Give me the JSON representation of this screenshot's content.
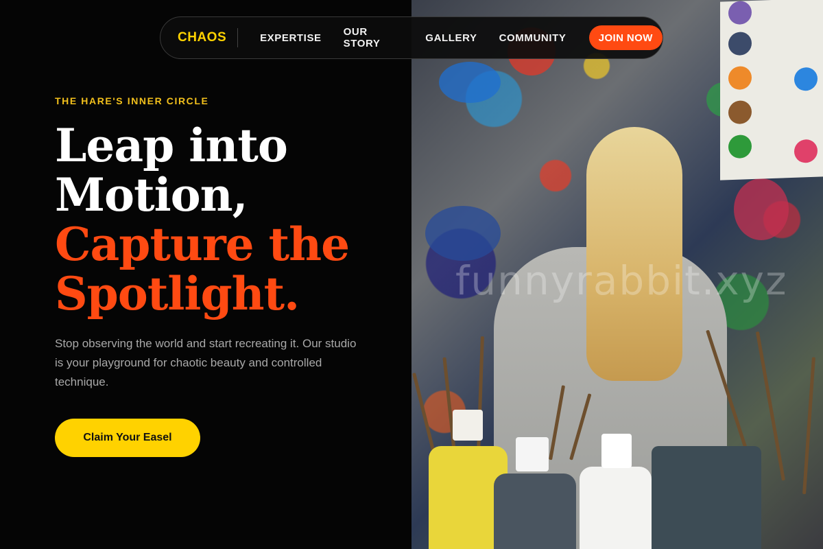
{
  "nav": {
    "brand": "CHAOS",
    "links": [
      "EXPERTISE",
      "OUR STORY",
      "GALLERY",
      "COMMUNITY"
    ],
    "cta": "JOIN NOW"
  },
  "hero": {
    "eyebrow": "THE HARE'S INNER CIRCLE",
    "headline_line1": "Leap into",
    "headline_line2": "Motion,",
    "headline_line3": "Capture the",
    "headline_line4": "Spotlight.",
    "subtext": "Stop observing the world and start recreating it. Our studio is your playground for chaotic beauty and controlled technique.",
    "cta": "Claim Your Easel"
  },
  "photo": {
    "watermark": "funnyrabbit.xyz"
  },
  "colors": {
    "accent_orange": "#ff4a12",
    "accent_yellow": "#ffd200",
    "background": "#050505"
  }
}
